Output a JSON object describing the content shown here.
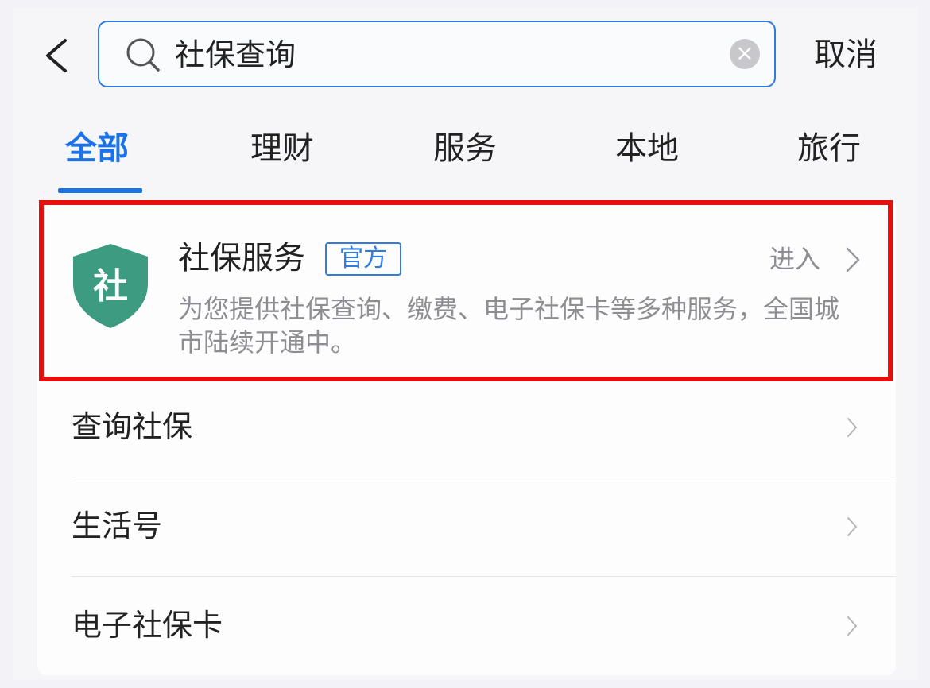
{
  "header": {
    "back_icon": "chevron-left-icon",
    "search": {
      "query": "社保查询",
      "icon": "search-icon",
      "clear_icon": "clear-icon"
    },
    "cancel_label": "取消"
  },
  "tabs": [
    {
      "label": "全部",
      "active": true
    },
    {
      "label": "理财",
      "active": false
    },
    {
      "label": "服务",
      "active": false
    },
    {
      "label": "本地",
      "active": false
    },
    {
      "label": "旅行",
      "active": false
    }
  ],
  "featured": {
    "icon_char": "社",
    "icon_color": "#3d9b82",
    "title": "社保服务",
    "badge": "官方",
    "action": "进入",
    "description": "为您提供社保查询、缴费、电子社保卡等多种服务，全国城市陆续开通中。"
  },
  "results": [
    {
      "label": "查询社保"
    },
    {
      "label": "生活号"
    },
    {
      "label": "电子社保卡"
    }
  ],
  "colors": {
    "accent": "#1a73e8",
    "highlight_border": "#e60f10"
  }
}
